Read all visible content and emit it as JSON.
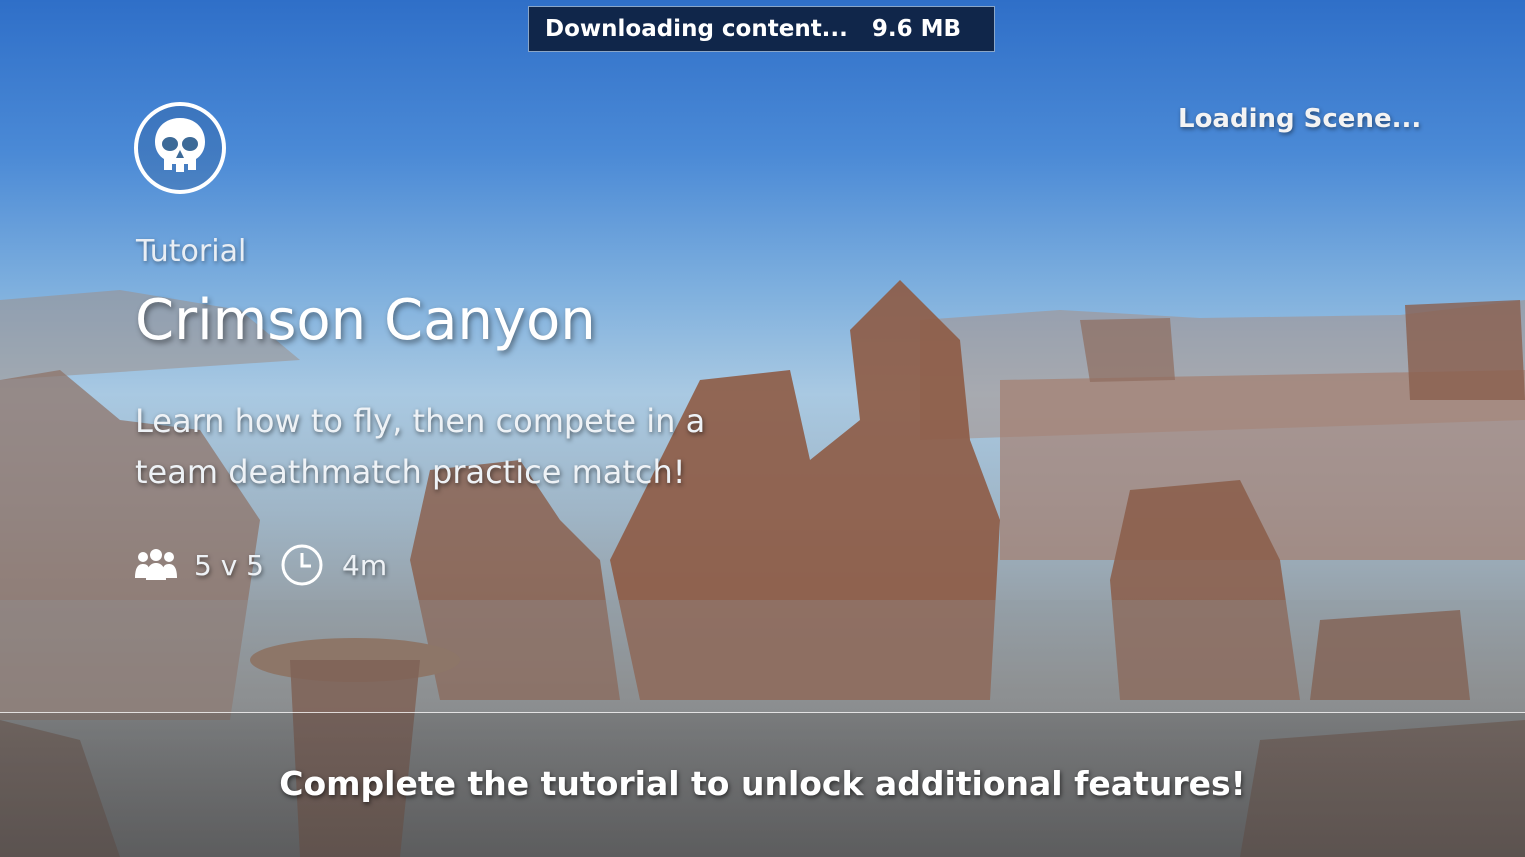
{
  "download": {
    "label": "Downloading content...",
    "size": "9.6 MB"
  },
  "status": {
    "loading": "Loading Scene..."
  },
  "mode": {
    "emblem_icon": "skull-icon",
    "label": "Tutorial"
  },
  "map": {
    "title": "Crimson Canyon",
    "description": "Learn how to fly, then compete in a team deathmatch practice match!"
  },
  "meta": {
    "players_icon": "players-icon",
    "players": "5 v 5",
    "time_icon": "clock-icon",
    "duration": "4m"
  },
  "footer": {
    "message": "Complete the tutorial to unlock additional features!"
  }
}
